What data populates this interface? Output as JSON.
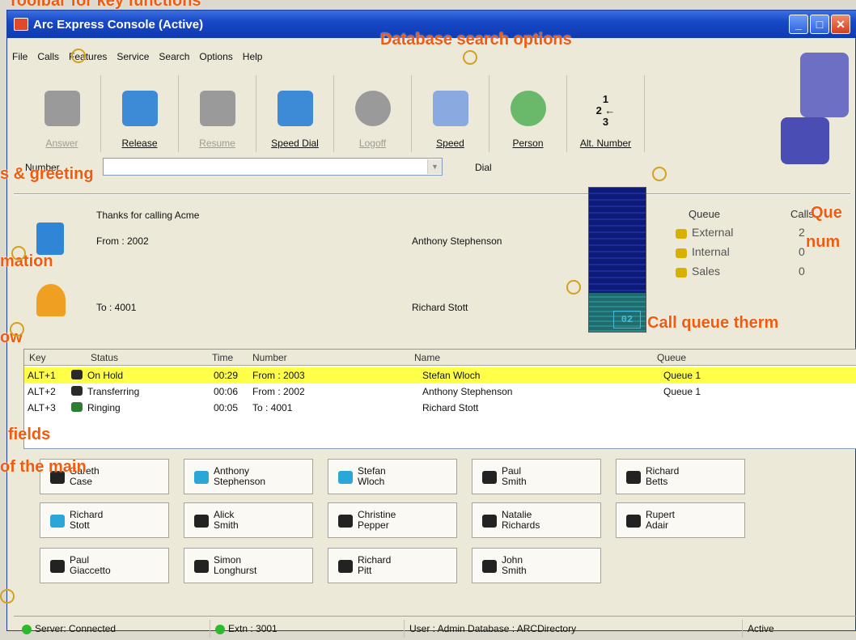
{
  "window": {
    "title": "Arc Express Console (Active)"
  },
  "menu": [
    "File",
    "Calls",
    "Features",
    "Service",
    "Search",
    "Options",
    "Help"
  ],
  "toolbar": [
    {
      "label": "Answer",
      "enabled": false,
      "icon": "phone-icon"
    },
    {
      "label": "Release",
      "enabled": true,
      "icon": "release-phone-icon"
    },
    {
      "label": "Resume",
      "enabled": false,
      "icon": "phone-icon"
    },
    {
      "label": "Speed Dial",
      "enabled": true,
      "icon": "speed-dial-icon"
    },
    {
      "label": "Logoff",
      "enabled": false,
      "icon": "logoff-icon"
    },
    {
      "label": "Speed",
      "enabled": true,
      "icon": "search-speed-icon"
    },
    {
      "label": "Person",
      "enabled": true,
      "icon": "search-person-icon"
    },
    {
      "label": "Alt. Number",
      "enabled": true,
      "icon": "alt-number-icon"
    }
  ],
  "number": {
    "label": "Number",
    "value": "",
    "dial_label": "Dial"
  },
  "greeting": "Thanks for calling Acme",
  "call": {
    "from": "From : 2002",
    "from_name": "Anthony Stephenson",
    "to": "To : 4001",
    "to_name": "Richard Stott"
  },
  "queue_display": {
    "count": "02"
  },
  "queues": {
    "headers": [
      "Queue",
      "Calls"
    ],
    "rows": [
      {
        "name": "External",
        "calls": "2"
      },
      {
        "name": "Internal",
        "calls": "0"
      },
      {
        "name": "Sales",
        "calls": "0"
      }
    ]
  },
  "calls_table": {
    "headers": [
      "Key",
      "Status",
      "Time",
      "Number",
      "Name",
      "Queue"
    ],
    "rows": [
      {
        "key": "ALT+1",
        "status": "On Hold",
        "time": "00:29",
        "number": "From : 2003",
        "name": "Stefan Wloch",
        "queue": "Queue 1",
        "highlight": true
      },
      {
        "key": "ALT+2",
        "status": "Transferring",
        "time": "00:06",
        "number": "From : 2002",
        "name": "Anthony Stephenson",
        "queue": "Queue 1",
        "highlight": false
      },
      {
        "key": "ALT+3",
        "status": "Ringing",
        "time": "00:05",
        "number": "To : 4001",
        "name": "Richard Stott",
        "queue": "",
        "highlight": false
      }
    ]
  },
  "speed_dials": [
    [
      "Gareth\nCase",
      "Anthony\nStephenson",
      "Stefan\nWloch",
      "Paul\nSmith",
      "Richard\nBetts"
    ],
    [
      "Richard\nStott",
      "Alick\nSmith",
      "Christine\nPepper",
      "Natalie\nRichards",
      "Rupert\nAdair"
    ],
    [
      "Paul\nGiaccetto",
      "Simon\nLonghurst",
      "Richard\nPitt",
      "John\nSmith"
    ]
  ],
  "status": {
    "server": "Server: Connected",
    "extn": "Extn : 3001",
    "user": "User : Admin  Database : ARCDirectory",
    "state": "Active"
  },
  "annotations": {
    "top": "Toolbar for key functions",
    "search": "Database search options",
    "greeting": "s & greeting",
    "info": "mation",
    "queue_num_1": "Que",
    "queue_num_2": "num",
    "thermo": "Call queue therm",
    "row": "ow",
    "fields": "fields",
    "main": "of the main"
  },
  "colors": {
    "highlight": "#ffff4a",
    "annotation": "#f25a0e",
    "title": "#1848c8"
  }
}
